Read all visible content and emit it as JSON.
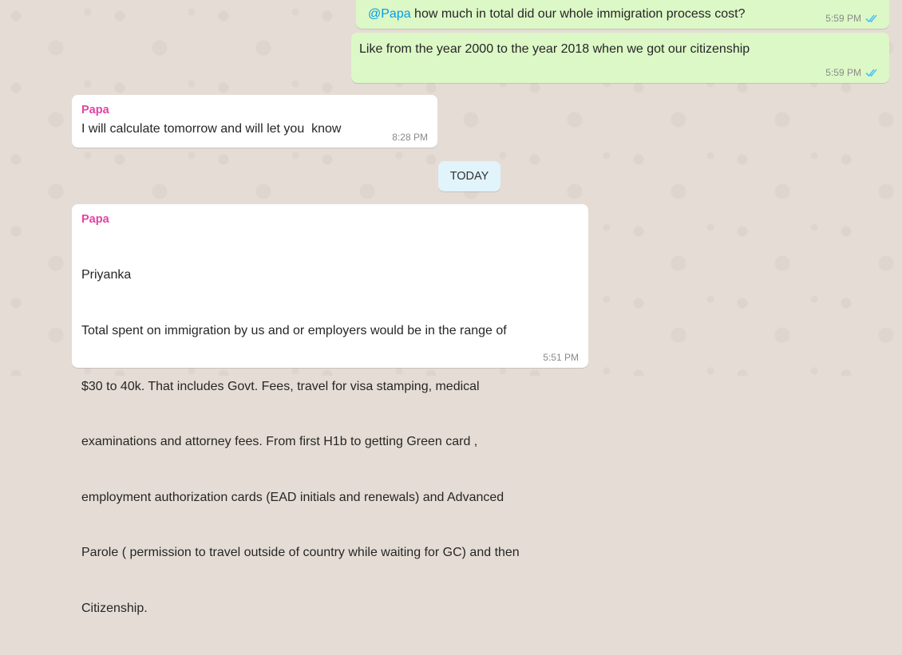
{
  "messages": [
    {
      "direction": "outgoing",
      "mention": "@Papa",
      "text": " how much in total did our whole immigration process cost?",
      "time": "5:59 PM",
      "status_icon": "double-check-read-icon"
    },
    {
      "direction": "outgoing",
      "text": "Like from the year 2000 to the year 2018 when we got our citizenship",
      "time": "5:59 PM",
      "status_icon": "double-check-read-icon"
    },
    {
      "direction": "incoming",
      "sender": "Papa",
      "text": "I will calculate tomorrow and will let you  know",
      "time": "8:28 PM"
    },
    {
      "direction": "incoming",
      "sender": "Papa",
      "lines": [
        "Priyanka",
        "Total spent on immigration by us and or employers would be in the range of",
        "$30 to 40k. That includes Govt. Fees, travel for visa stamping, medical",
        "examinations and attorney fees. From first H1b to getting Green card ,",
        "employment authorization cards (EAD initials and renewals) and Advanced",
        "Parole ( permission to travel outside of country while waiting for GC) and then",
        "Citizenship."
      ],
      "time": "5:51 PM"
    }
  ],
  "date_divider": "TODAY",
  "colors": {
    "background": "#e5ddd5",
    "outgoing_bubble": "#dcf8c6",
    "incoming_bubble": "#ffffff",
    "sender_name": "#e542a3",
    "mention": "#039be5",
    "read_ticks": "#4fc3f7",
    "date_pill": "#e1f3fb"
  }
}
